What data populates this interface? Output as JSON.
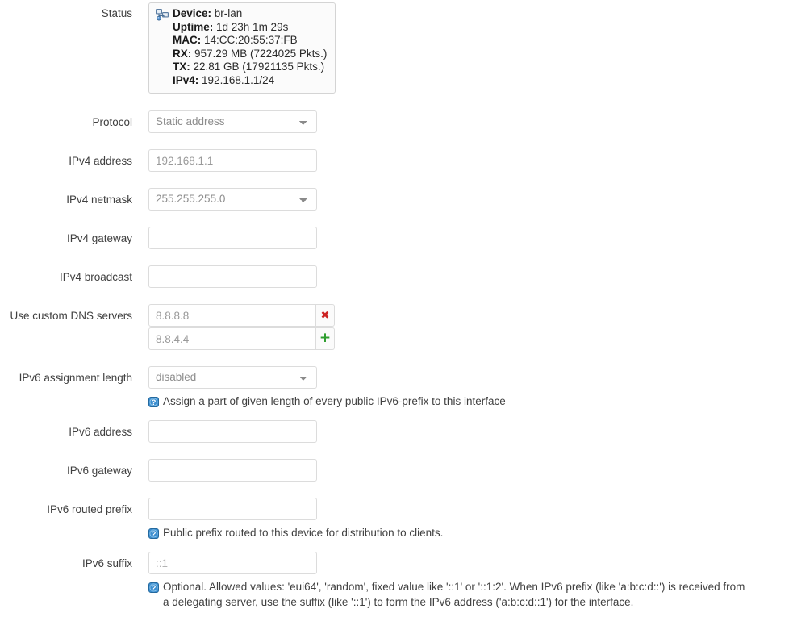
{
  "status": {
    "label": "Status",
    "icon": "network-interface-icon",
    "lines": [
      {
        "key": "Device:",
        "value": "br-lan"
      },
      {
        "key": "Uptime:",
        "value": "1d 23h 1m 29s"
      },
      {
        "key": "MAC:",
        "value": "14:CC:20:55:37:FB"
      },
      {
        "key": "RX:",
        "value": "957.29 MB (7224025 Pkts.)"
      },
      {
        "key": "TX:",
        "value": "22.81 GB (17921135 Pkts.)"
      },
      {
        "key": "IPv4:",
        "value": "192.168.1.1/24"
      }
    ]
  },
  "fields": {
    "protocol": {
      "label": "Protocol",
      "value": "Static address",
      "options": [
        "Static address"
      ]
    },
    "ipv4_address": {
      "label": "IPv4 address",
      "value": "192.168.1.1",
      "placeholder": ""
    },
    "ipv4_netmask": {
      "label": "IPv4 netmask",
      "value": "255.255.255.0",
      "options": [
        "255.255.255.0"
      ]
    },
    "ipv4_gateway": {
      "label": "IPv4 gateway",
      "value": "",
      "placeholder": ""
    },
    "ipv4_broadcast": {
      "label": "IPv4 broadcast",
      "value": "",
      "placeholder": ""
    },
    "dns_servers": {
      "label": "Use custom DNS servers",
      "entries": [
        {
          "value": "8.8.8.8",
          "action": "remove",
          "action_glyph": "✖"
        },
        {
          "value": "8.8.4.4",
          "action": "add",
          "action_glyph": "+"
        }
      ]
    },
    "ipv6_assignment_length": {
      "label": "IPv6 assignment length",
      "value": "disabled",
      "options": [
        "disabled"
      ],
      "help": "Assign a part of given length of every public IPv6-prefix to this interface"
    },
    "ipv6_address": {
      "label": "IPv6 address",
      "value": "",
      "placeholder": ""
    },
    "ipv6_gateway": {
      "label": "IPv6 gateway",
      "value": "",
      "placeholder": ""
    },
    "ipv6_routed_prefix": {
      "label": "IPv6 routed prefix",
      "value": "",
      "placeholder": "",
      "help": "Public prefix routed to this device for distribution to clients."
    },
    "ipv6_suffix": {
      "label": "IPv6 suffix",
      "value": "",
      "placeholder": "::1",
      "help": "Optional. Allowed values: 'eui64', 'random', fixed value like '::1' or '::1:2'. When IPv6 prefix (like 'a:b:c:d::') is received from a delegating server, use the suffix (like '::1') to form the IPv6 address ('a:b:c:d::1') for the interface."
    }
  },
  "colors": {
    "remove_button": "#cc2222",
    "add_button": "#2e9e2e",
    "help_icon": "#3c8ed0",
    "border": "#dcdcdc",
    "text": "#404040"
  }
}
